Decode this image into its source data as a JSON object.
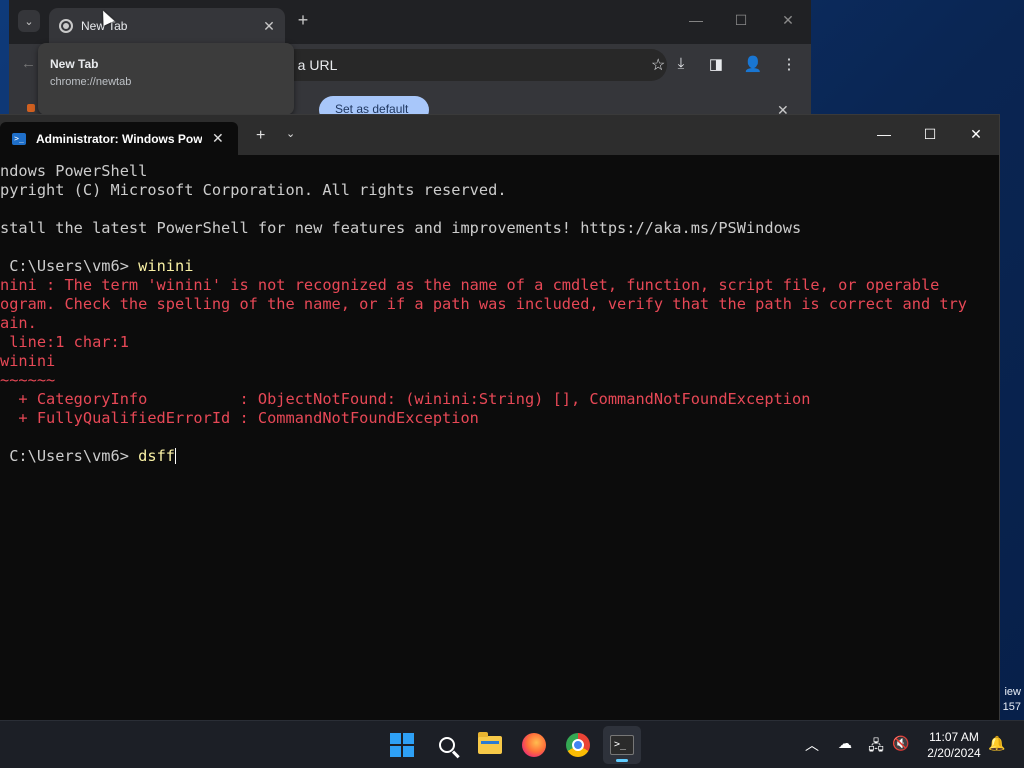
{
  "desktop": {
    "edge_text_1": "iew",
    "edge_text_2": "157"
  },
  "chrome": {
    "tab_title": "New Tab",
    "tab_close": "✕",
    "new_tab_symbol": "+",
    "tab_search_symbol": "⌄",
    "omnibox_text": "e a URL",
    "star_symbol": "☆",
    "back_symbol": "←",
    "download_symbol": "⤓",
    "side_panel_symbol": "◨",
    "profile_symbol": "👤",
    "menu_symbol": "⋮",
    "minimize_symbol": "—",
    "maximize_symbol": "☐",
    "close_symbol": "✕",
    "bookmark_pill_text": "Set as default",
    "strip_close_symbol": "✕",
    "tooltip": {
      "title": "New Tab",
      "url": "chrome://newtab"
    }
  },
  "terminal": {
    "tab_title": "Administrator: Windows PowerShell",
    "tab_close": "✕",
    "new_tab_symbol": "+",
    "dropdown_symbol": "⌄",
    "minimize_symbol": "—",
    "maximize_symbol": "☐",
    "close_symbol": "✕",
    "lines": {
      "l1": "ndows PowerShell",
      "l2": "pyright (C) Microsoft Corporation. All rights reserved.",
      "l3": "",
      "l4": "stall the latest PowerShell for new features and improvements! https://aka.ms/PSWindows",
      "l5": "",
      "l6_prompt": " C:\\Users\\vm6> ",
      "l6_cmd": "winini",
      "l7": "nini : The term 'winini' is not recognized as the name of a cmdlet, function, script file, or operable",
      "l8": "ogram. Check the spelling of the name, or if a path was included, verify that the path is correct and try",
      "l9": "ain.",
      "l10": " line:1 char:1",
      "l11": "winini",
      "l12": "~~~~~~",
      "l13": "  + CategoryInfo          : ObjectNotFound: (winini:String) [], CommandNotFoundException",
      "l14": "  + FullyQualifiedErrorId : CommandNotFoundException",
      "l15": "",
      "l16_prompt": " C:\\Users\\vm6> ",
      "l16_cmd": "dsff"
    }
  },
  "taskbar": {
    "apps": [
      "start",
      "search",
      "file-explorer",
      "firefox",
      "chrome",
      "terminal"
    ],
    "tray": {
      "chevron_symbol": "︿",
      "onedrive_symbol": "☁",
      "network_symbol": "🖧",
      "volume_symbol": "🔇",
      "notification_symbol": "🔔",
      "time": "11:07 AM",
      "date": "2/20/2024"
    },
    "colors": {
      "accent": "#60cdff"
    }
  },
  "colors": {
    "terminal_bg": "#0c0c0c",
    "error_text": "#e74856",
    "command_text": "#f9f1a5",
    "default_text": "#cccccc"
  }
}
